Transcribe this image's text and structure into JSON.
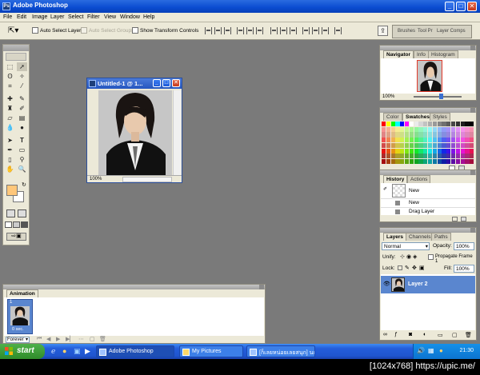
{
  "window": {
    "title": "Adobe Photoshop",
    "buttons": {
      "minimize": "_",
      "maximize": "□",
      "close": "✕"
    }
  },
  "menu": [
    "File",
    "Edit",
    "Image",
    "Layer",
    "Select",
    "Filter",
    "View",
    "Window",
    "Help"
  ],
  "options_bar": {
    "auto_select_layer": "Auto Select Layer",
    "auto_select_groups": "Auto Select Groups",
    "show_transform_controls": "Show Transform Controls",
    "palette_well_tabs": [
      "Brushes",
      "Tool Pr",
      "Layer Comps"
    ]
  },
  "document": {
    "title": "Untitled-1 @ 1...",
    "zoom": "100%"
  },
  "navigator": {
    "tabs": [
      "Navigator",
      "Info",
      "Histogram"
    ],
    "zoom": "100%"
  },
  "swatches": {
    "tabs": [
      "Color",
      "Swatches",
      "Styles"
    ]
  },
  "history": {
    "tabs": [
      "History",
      "Actions"
    ],
    "snapshot_label": "New",
    "items": [
      "New",
      "Drag Layer"
    ]
  },
  "layers": {
    "tabs": [
      "Layers",
      "Channels",
      "Paths"
    ],
    "blend_mode": "Normal",
    "opacity_label": "Opacity:",
    "opacity": "100%",
    "unify_label": "Unify:",
    "propagate_label": "Propagate Frame 1",
    "lock_label": "Lock:",
    "fill_label": "Fill:",
    "fill": "100%",
    "layer_name": "Layer 2"
  },
  "animation": {
    "tab": "Animation",
    "frame_number": "1",
    "frame_delay": "0 sec.",
    "loop": "Forever"
  },
  "taskbar": {
    "start": "start",
    "tasks": [
      "Adobe Photoshop",
      "My Pictures",
      "[ก็เลยหน่อยเลยสนุก] นก ..."
    ],
    "clock": "21:30"
  },
  "info_strip": "[1024x768] https://upic.me/",
  "colors": {
    "xp_blue": "#0a4bd0",
    "workspace_gray": "#7a7a7a",
    "panel_beige": "#ece9d8",
    "foreground_swatch": "#ffc77a",
    "layer_highlight": "#5a86cf"
  }
}
